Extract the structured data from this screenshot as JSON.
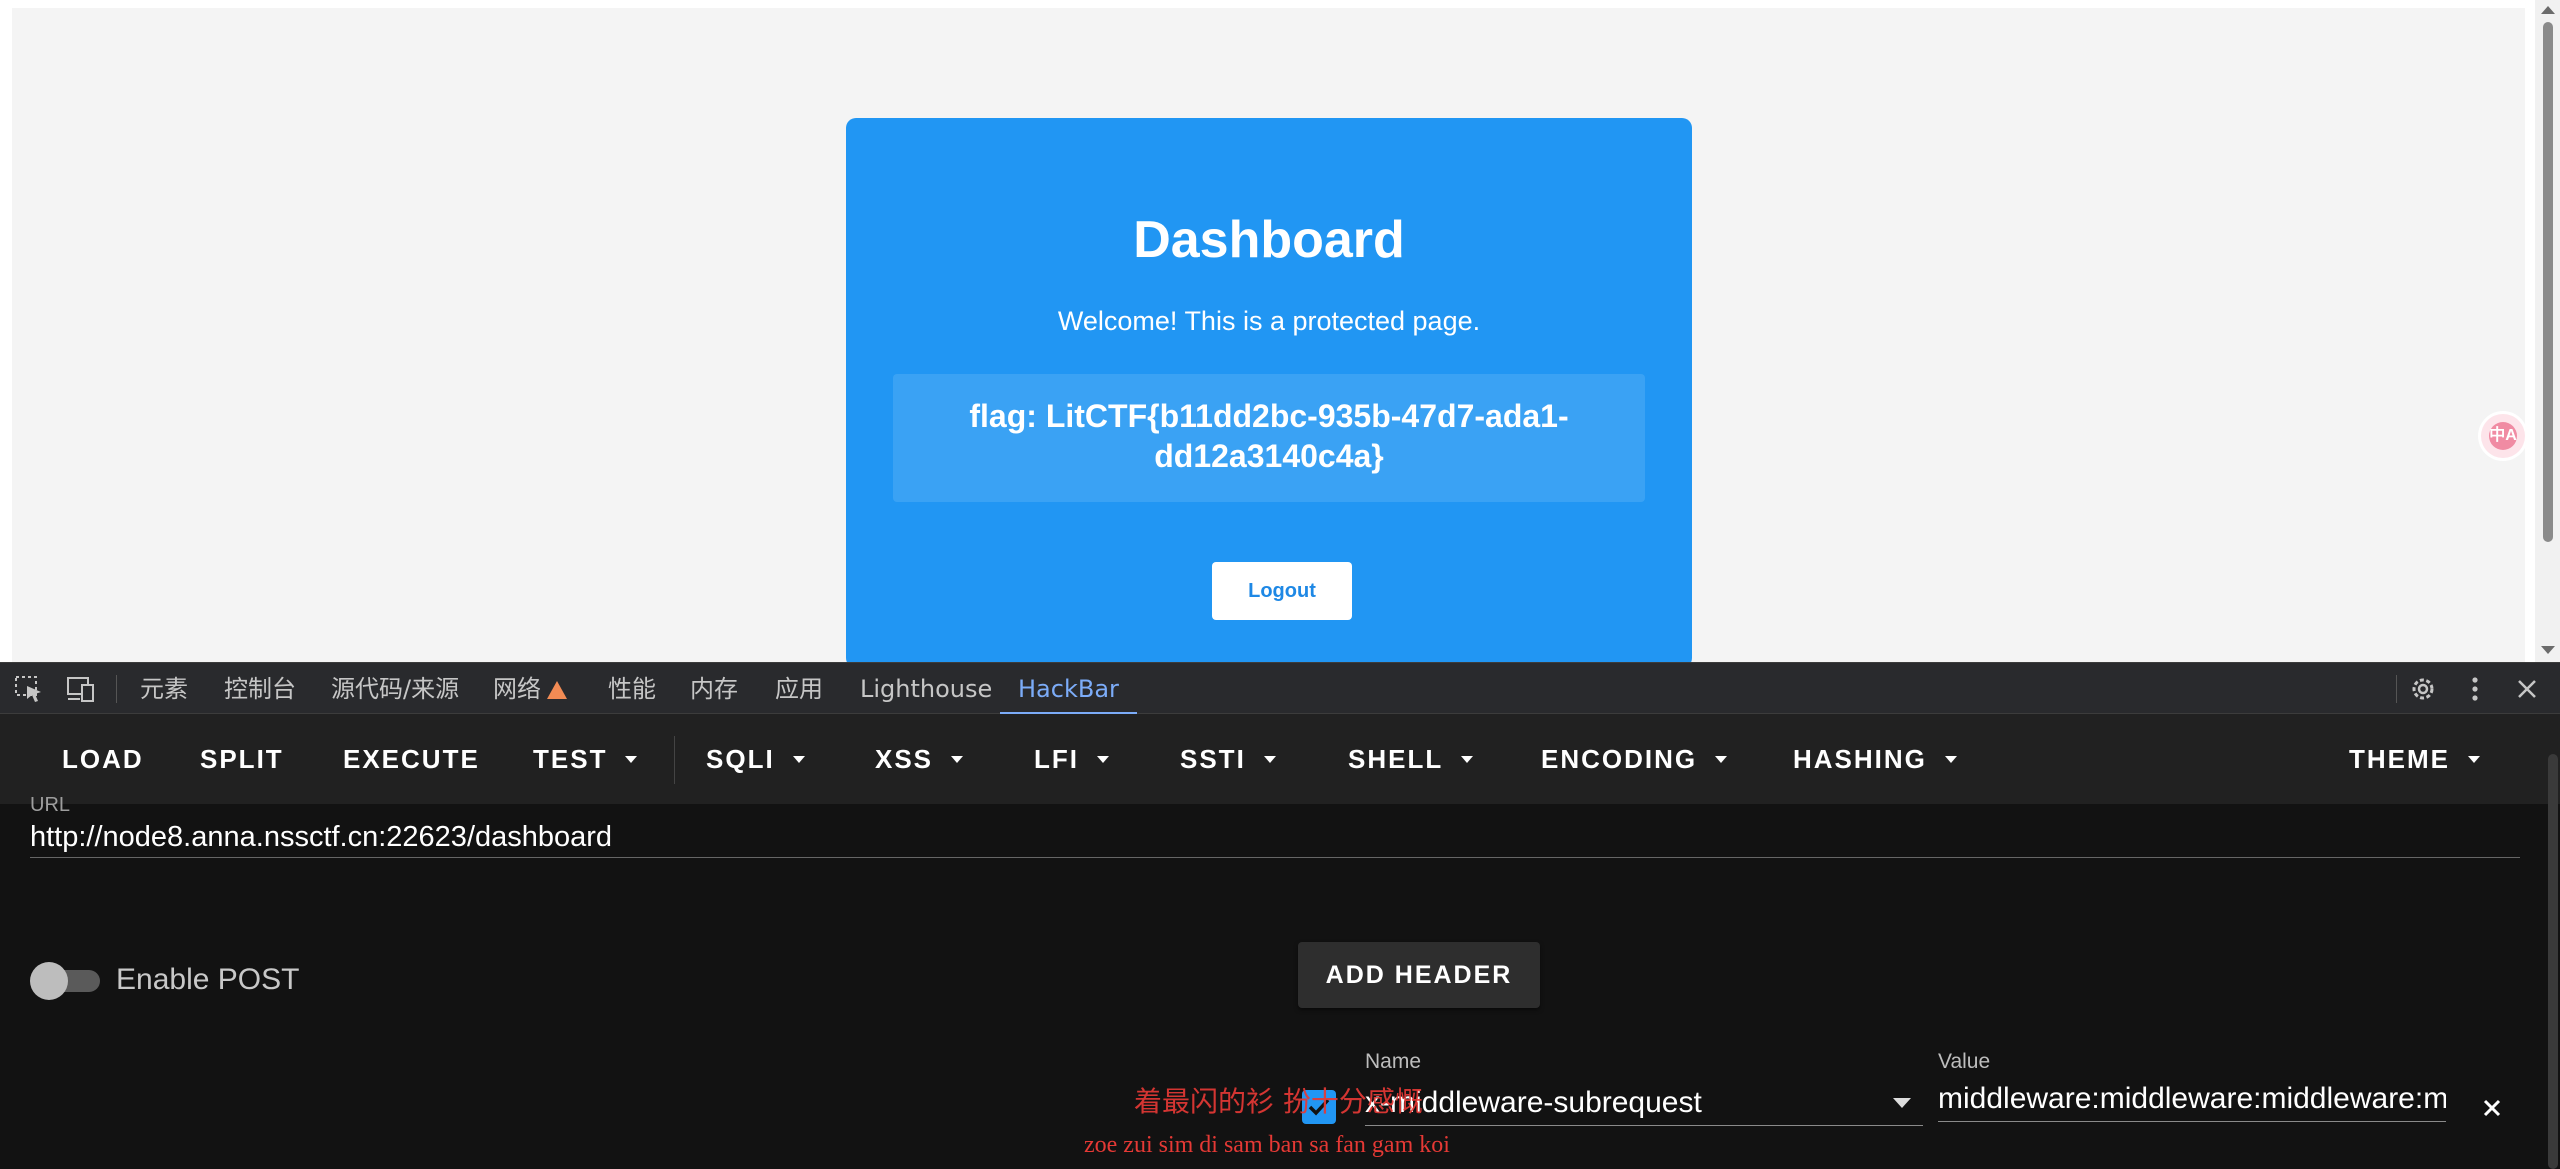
{
  "page": {
    "card": {
      "title": "Dashboard",
      "welcome": "Welcome! This is a protected page.",
      "flag": "flag: LitCTF{b11dd2bc-935b-47d7-ada1-dd12a3140c4a}",
      "logout_label": "Logout",
      "background": "#2196f3"
    },
    "translate_icon_text": "中A"
  },
  "devtools": {
    "tabs": [
      {
        "label": "元素"
      },
      {
        "label": "控制台"
      },
      {
        "label": "源代码/来源"
      },
      {
        "label": "网络"
      },
      {
        "label": "性能"
      },
      {
        "label": "内存"
      },
      {
        "label": "应用"
      },
      {
        "label": "Lighthouse"
      },
      {
        "label": "HackBar",
        "active": true
      }
    ],
    "accent": "#7cacf8",
    "warning_color": "#f28b54"
  },
  "hackbar": {
    "toolbar": {
      "load": "LOAD",
      "split": "SPLIT",
      "execute": "EXECUTE",
      "test": "TEST",
      "sqli": "SQLI",
      "xss": "XSS",
      "lfi": "LFI",
      "ssti": "SSTI",
      "shell": "SHELL",
      "encoding": "ENCODING",
      "hashing": "HASHING",
      "theme": "THEME"
    },
    "url_label": "URL",
    "url_value": "http://node8.anna.nssctf.cn:22623/dashboard",
    "enable_post_label": "Enable POST",
    "enable_post_on": false,
    "add_header_label": "ADD HEADER",
    "header": {
      "enabled": true,
      "name_label": "Name",
      "name_value": "x-middleware-subrequest",
      "value_label": "Value",
      "value_value": "middleware:middleware:middleware:middleware:middleware"
    }
  },
  "subtitle": {
    "chinese": "着最闪的衫 扮十分感慨",
    "romanized": "zoe zui sim di sam ban sa fan gam koi",
    "color": "#e53935"
  }
}
